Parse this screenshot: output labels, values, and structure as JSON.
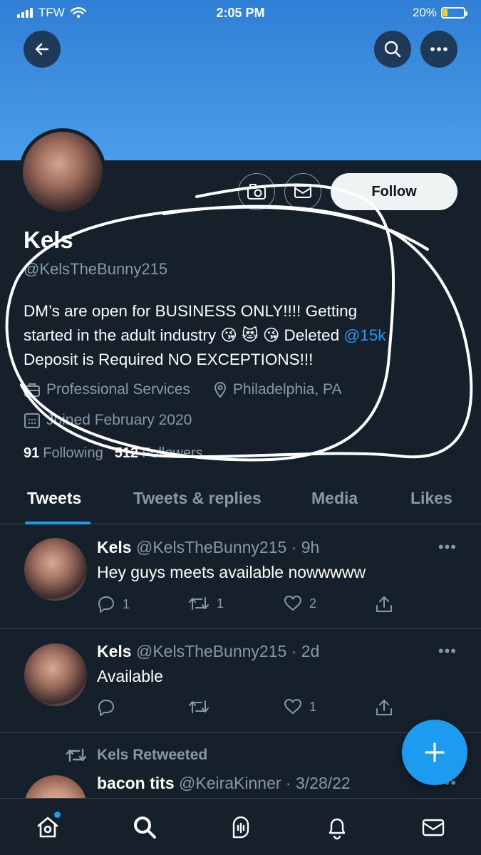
{
  "status_bar": {
    "carrier": "TFW",
    "time": "2:05 PM",
    "battery": "20%",
    "battery_level": 0.2
  },
  "profile": {
    "name": "Kels",
    "handle": "@KelsTheBunny215",
    "follow_label": "Follow",
    "bio_line1": "DM’s are open for BUSINESS ONLY!!!! Getting",
    "bio_line2_pre": "started in the adult industry 😘 😻 😘 Deleted ",
    "bio_mention": "@15k",
    "bio_line3": "Deposit is Required NO EXCEPTIONS!!!",
    "category": "Professional Services",
    "location": "Philadelphia, PA",
    "joined": "Joined February 2020",
    "following_count": "91",
    "following_label": "Following",
    "followers_count": "512",
    "followers_label": "Followers"
  },
  "tabs": [
    {
      "label": "Tweets"
    },
    {
      "label": "Tweets & replies"
    },
    {
      "label": "Media"
    },
    {
      "label": "Likes"
    }
  ],
  "tweets": [
    {
      "name": "Kels",
      "meta": "@KelsTheBunny215 · 9h",
      "text": "Hey guys meets available nowwwww",
      "replies": "1",
      "retweets": "1",
      "likes": "2"
    },
    {
      "name": "Kels",
      "meta": "@KelsTheBunny215 · 2d",
      "text": "Available",
      "replies": "",
      "retweets": "",
      "likes": "1"
    }
  ],
  "retweet": {
    "label": "Kels Retweeted",
    "name": "bacon tits",
    "meta": "@KeiraKinner · 3/28/22"
  },
  "colors": {
    "background": "#15202b",
    "accent": "#1d9bf0",
    "muted": "#8899a6"
  }
}
